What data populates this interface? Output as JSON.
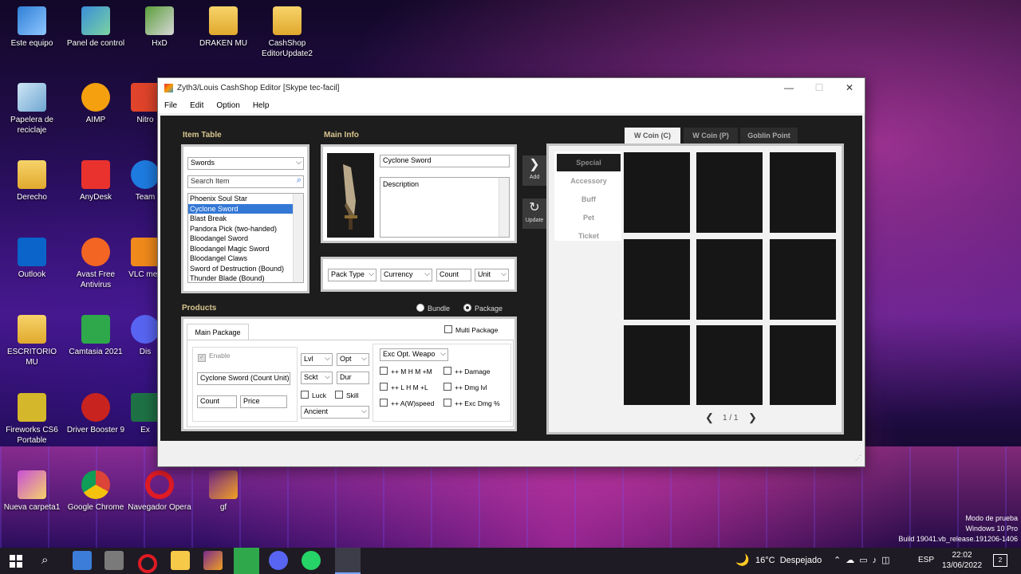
{
  "desktop": {
    "icons": [
      {
        "label": "Este equipo"
      },
      {
        "label": "Panel de control"
      },
      {
        "label": "HxD"
      },
      {
        "label": "DRAKEN MU"
      },
      {
        "label": "CashShop EditorUpdate2"
      },
      {
        "label": "Papelera de reciclaje"
      },
      {
        "label": "AIMP"
      },
      {
        "label": "Nitro"
      },
      {
        "label": "Derecho"
      },
      {
        "label": "AnyDesk"
      },
      {
        "label": "Team"
      },
      {
        "label": "Outlook"
      },
      {
        "label": "Avast Free Antivirus"
      },
      {
        "label": "VLC med"
      },
      {
        "label": "ESCRITORIO MU"
      },
      {
        "label": "Camtasia 2021"
      },
      {
        "label": "Dis"
      },
      {
        "label": "Fireworks CS6 Portable"
      },
      {
        "label": "Driver Booster 9"
      },
      {
        "label": "Ex"
      },
      {
        "label": "Nueva carpeta1"
      },
      {
        "label": "Google Chrome"
      },
      {
        "label": "Navegador Opera"
      },
      {
        "label": "gf"
      }
    ],
    "watermark": {
      "line1": "Modo de prueba",
      "line2": "Windows 10 Pro",
      "line3": "Build 19041.vb_release.191206-1406"
    }
  },
  "window": {
    "title": "Zyth3/Louis CashShop Editor [Skype tec-facil]",
    "controls": {
      "minimize": "—",
      "maximize": "☐",
      "close": "✕"
    },
    "menu": [
      "File",
      "Edit",
      "Option",
      "Help"
    ]
  },
  "item_table": {
    "header": "Item Table",
    "category": "Swords",
    "search_placeholder": "Search Item",
    "items": [
      "Phoenix Soul Star",
      "Cyclone Sword",
      "Blast Break",
      "Pandora Pick (two-handed)",
      "Bloodangel Sword",
      "Bloodangel Magic Sword",
      "Bloodangel Claws",
      "Sword of Destruction (Bound)",
      "Thunder Blade (Bound)"
    ],
    "selected_index": 1
  },
  "main_info": {
    "header": "Main Info",
    "name": "Cyclone Sword",
    "description": "Description",
    "pack_type": "Pack Type",
    "currency": "Currency",
    "count": "Count",
    "unit": "Unit"
  },
  "side_buttons": {
    "add": "Add",
    "update": "Update"
  },
  "products": {
    "header": "Products",
    "bundle": "Bundle",
    "package": "Package",
    "tab": "Main Package",
    "multi_package": "Multi Package",
    "enable": "Enable",
    "item_name": "Cyclone Sword (Count Unit)",
    "count": "Count",
    "price": "Price",
    "lvl": "Lvl",
    "opt": "Opt",
    "sckt": "Sckt",
    "dur": "Dur",
    "luck": "Luck",
    "skill": "Skill",
    "ancient": "Ancient",
    "exc_opt": "Exc Opt. Weapo",
    "exc_options": [
      "++ M H M +M",
      "++ Damage",
      "++ L H M +L",
      "++ Dmg lvl",
      "++ A(W)speed",
      "++ Exc Dmg %"
    ]
  },
  "shop": {
    "tabs": [
      "W Coin (C)",
      "W Coin (P)",
      "Goblin Point"
    ],
    "active_tab": 0,
    "categories": [
      "Special",
      "Accessory",
      "Buff",
      "Pet",
      "Ticket"
    ],
    "active_category": 0,
    "page": "1 / 1",
    "prev": "❮",
    "next": "❯"
  },
  "taskbar": {
    "weather_icon": "🌙",
    "weather": "16°C  Despejado",
    "lang": "ESP",
    "time": "22:02",
    "date": "13/06/2022",
    "notif": "2"
  }
}
